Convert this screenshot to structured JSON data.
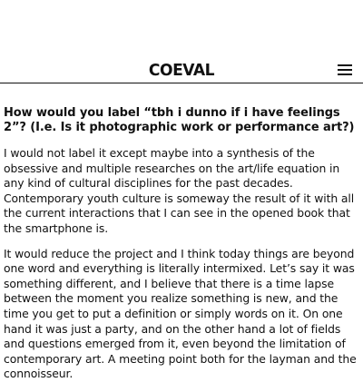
{
  "header": {
    "logo_text": "COEVAL",
    "menu_icon": "hamburger-menu-icon"
  },
  "article": {
    "question": "How would you label “tbh i dunno if i have feelings 2”? (I.e. Is it photographic work or performance art?)",
    "paragraphs": [
      "I would not label it except maybe into a synthesis of the obsessive and multiple researches on the art/life equation in any kind of cultural disciplines for the past decades. Contemporary youth culture is someway the result of it with all the current interactions that I can see in the opened book that the smartphone is.",
      "It would reduce the project and I think today things are beyond one word and everything is literally intermixed. Let’s say it was something different, and I believe that there is a time lapse between the moment you realize something is new, and the time you get to put a definition or simply words on it. On one hand it was just a party, and on the other hand a lot of fields and questions emerged from it, even beyond the limitation of contemporary art. A meeting point both for the layman and the connoisseur."
    ]
  }
}
